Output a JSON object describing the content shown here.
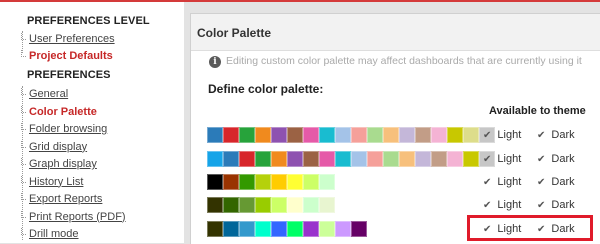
{
  "sidebar": {
    "preferences_level_title": "PREFERENCES LEVEL",
    "level_items": [
      {
        "label": "User Preferences",
        "active": false
      },
      {
        "label": "Project Defaults",
        "active": true
      }
    ],
    "preferences_title": "PREFERENCES",
    "pref_items": [
      {
        "label": "General",
        "active": false
      },
      {
        "label": "Color Palette",
        "active": true
      },
      {
        "label": "Folder browsing",
        "active": false
      },
      {
        "label": "Grid display",
        "active": false
      },
      {
        "label": "Graph display",
        "active": false
      },
      {
        "label": "History List",
        "active": false
      },
      {
        "label": "Export Reports",
        "active": false
      },
      {
        "label": "Print Reports (PDF)",
        "active": false
      },
      {
        "label": "Drill mode",
        "active": false
      }
    ]
  },
  "panel": {
    "title": "Color Palette",
    "info_icon": "info-icon",
    "info_text": "Editing custom color palette may affect dashboards that are currently using it",
    "define_label": "Define color palette:",
    "available_header": "Available to theme"
  },
  "palettes": [
    {
      "colors": [
        "#2b7bb9",
        "#d7262b",
        "#27a33b",
        "#f08a1e",
        "#8e52b0",
        "#9b6244",
        "#e55aa8",
        "#19bcd0",
        "#a4c3e8",
        "#f5a09a",
        "#a9db8f",
        "#f7c07c",
        "#c4b7d9",
        "#c29d87",
        "#f4b3d4",
        "#c8c800",
        "#dddd8b",
        "#c7c7c7"
      ],
      "light_label": "Light",
      "dark_label": "Dark",
      "highlighted": false
    },
    {
      "colors": [
        "#16a4e8",
        "#2b7bb9",
        "#d7262b",
        "#27a33b",
        "#f08a1e",
        "#8e52b0",
        "#9b6244",
        "#e55aa8",
        "#19bcd0",
        "#a4c3e8",
        "#f5a09a",
        "#a9db8f",
        "#f7c07c",
        "#c4b7d9",
        "#c29d87",
        "#f4b3d4",
        "#c8c800",
        "#c7c7c7"
      ],
      "light_label": "Light",
      "dark_label": "Dark",
      "highlighted": false
    },
    {
      "colors": [
        "#000000",
        "#993300",
        "#339900",
        "#b5d10b",
        "#ffcc00",
        "#ffff33",
        "#ccff66",
        "#ccffcc"
      ],
      "light_label": "Light",
      "dark_label": "Dark",
      "highlighted": false
    },
    {
      "colors": [
        "#333300",
        "#336600",
        "#669933",
        "#99cc00",
        "#ccff66",
        "#ffffcc",
        "#ccffcc",
        "#e8f5d0"
      ],
      "light_label": "Light",
      "dark_label": "Dark",
      "highlighted": false
    },
    {
      "colors": [
        "#333300",
        "#006699",
        "#3399cc",
        "#00ffcc",
        "#3366ff",
        "#00ff66",
        "#9933cc",
        "#ccff99",
        "#cc99ff",
        "#660066"
      ],
      "light_label": "Light",
      "dark_label": "Dark",
      "highlighted": true
    }
  ],
  "colors": {
    "accent_red": "#c62828",
    "highlight_red": "#e01b2a"
  }
}
